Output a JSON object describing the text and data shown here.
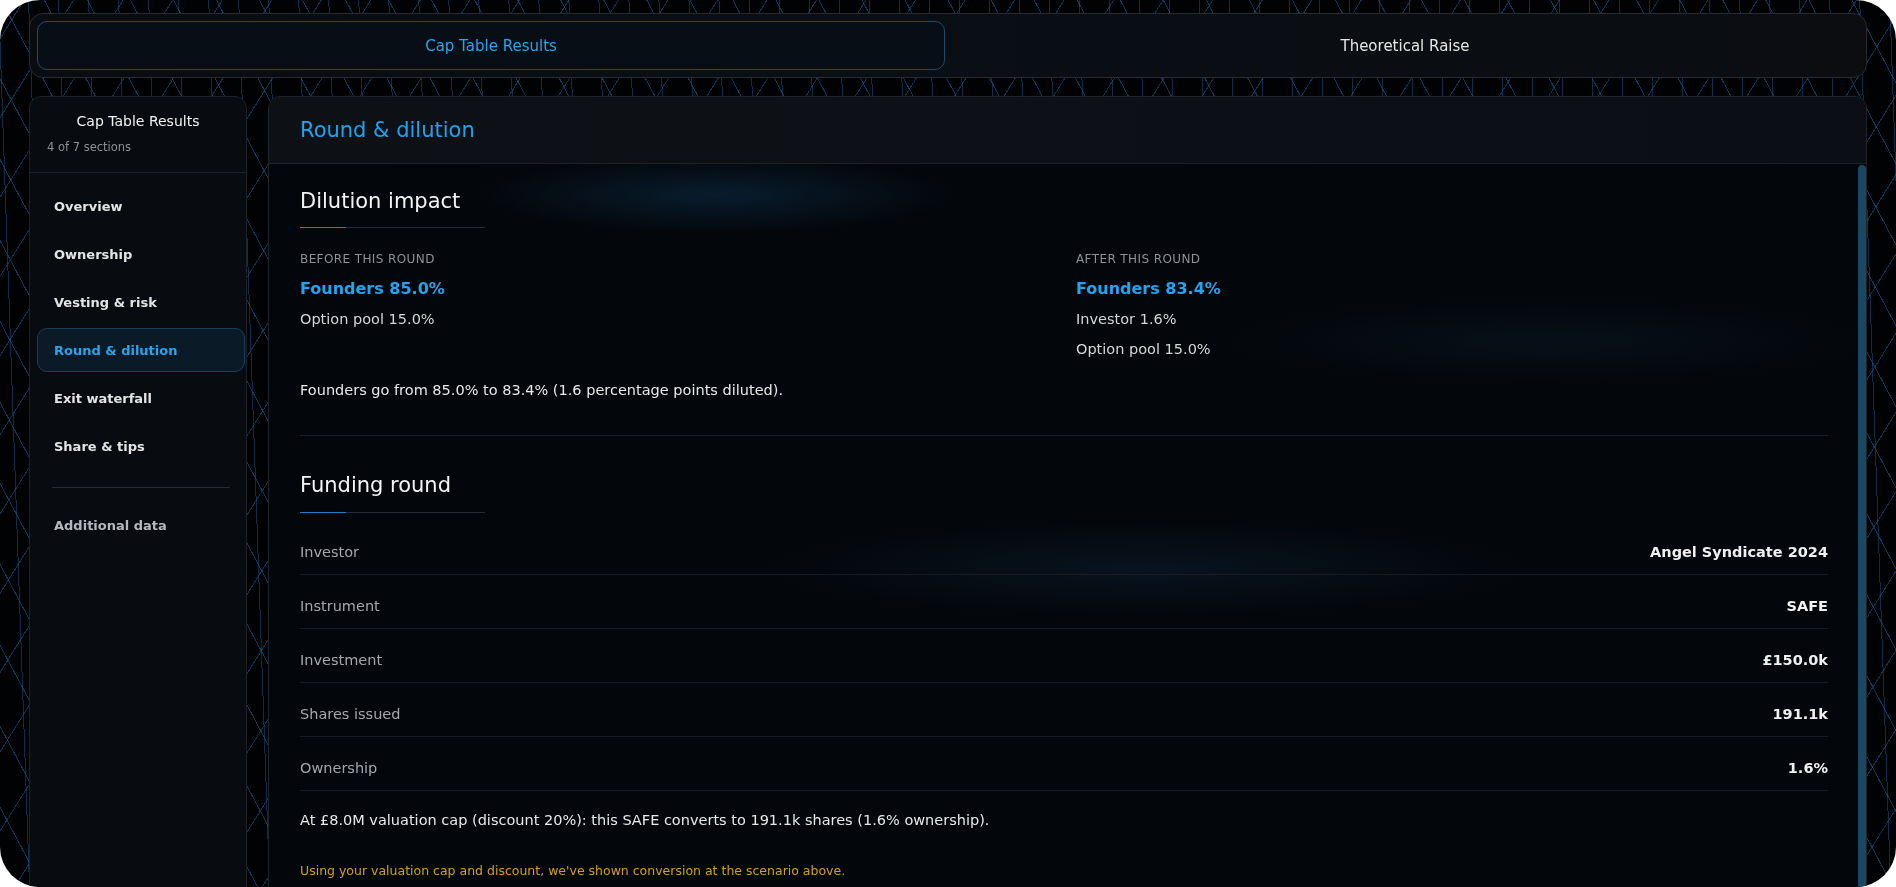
{
  "tabs": [
    {
      "label": "Cap Table Results",
      "selected": true
    },
    {
      "label": "Theoretical Raise",
      "selected": false
    }
  ],
  "sidebar": {
    "title": "Cap Table Results",
    "subtitle": "4 of 7 sections",
    "items": [
      {
        "label": "Overview",
        "selected": false
      },
      {
        "label": "Ownership",
        "selected": false
      },
      {
        "label": "Vesting & risk",
        "selected": false
      },
      {
        "label": "Round & dilution",
        "selected": true
      },
      {
        "label": "Exit waterfall",
        "selected": false
      },
      {
        "label": "Share & tips",
        "selected": false
      }
    ],
    "extra_items": [
      {
        "label": "Additional data",
        "selected": false
      }
    ]
  },
  "panel": {
    "title": "Round & dilution",
    "dilution_impact": {
      "heading": "Dilution impact",
      "columns": [
        {
          "label": "BEFORE THIS ROUND",
          "lines": [
            {
              "kind": "highlight",
              "text": "Founders 85.0%"
            },
            {
              "kind": "plain",
              "text": "Option pool 15.0%"
            }
          ]
        },
        {
          "label": "AFTER THIS ROUND",
          "lines": [
            {
              "kind": "highlight",
              "text": "Founders 83.4%"
            },
            {
              "kind": "plain",
              "text": "Investor 1.6%"
            },
            {
              "kind": "plain",
              "text": "Option pool 15.0%"
            }
          ]
        }
      ],
      "summary": "Founders go from 85.0% to 83.4% (1.6 percentage points diluted)."
    },
    "funding_round": {
      "heading": "Funding round",
      "rows": [
        {
          "label": "Investor",
          "value": "Angel Syndicate 2024"
        },
        {
          "label": "Instrument",
          "value": "SAFE"
        },
        {
          "label": "Investment",
          "value": "£150.0k"
        },
        {
          "label": "Shares issued",
          "value": "191.1k"
        },
        {
          "label": "Ownership",
          "value": "1.6%"
        }
      ],
      "summary": "At £8.0M valuation cap (discount 20%): this SAFE converts to 191.1k shares (1.6% ownership).",
      "note": "Using your valuation cap and discount, we've shown conversion at the scenario above."
    }
  }
}
